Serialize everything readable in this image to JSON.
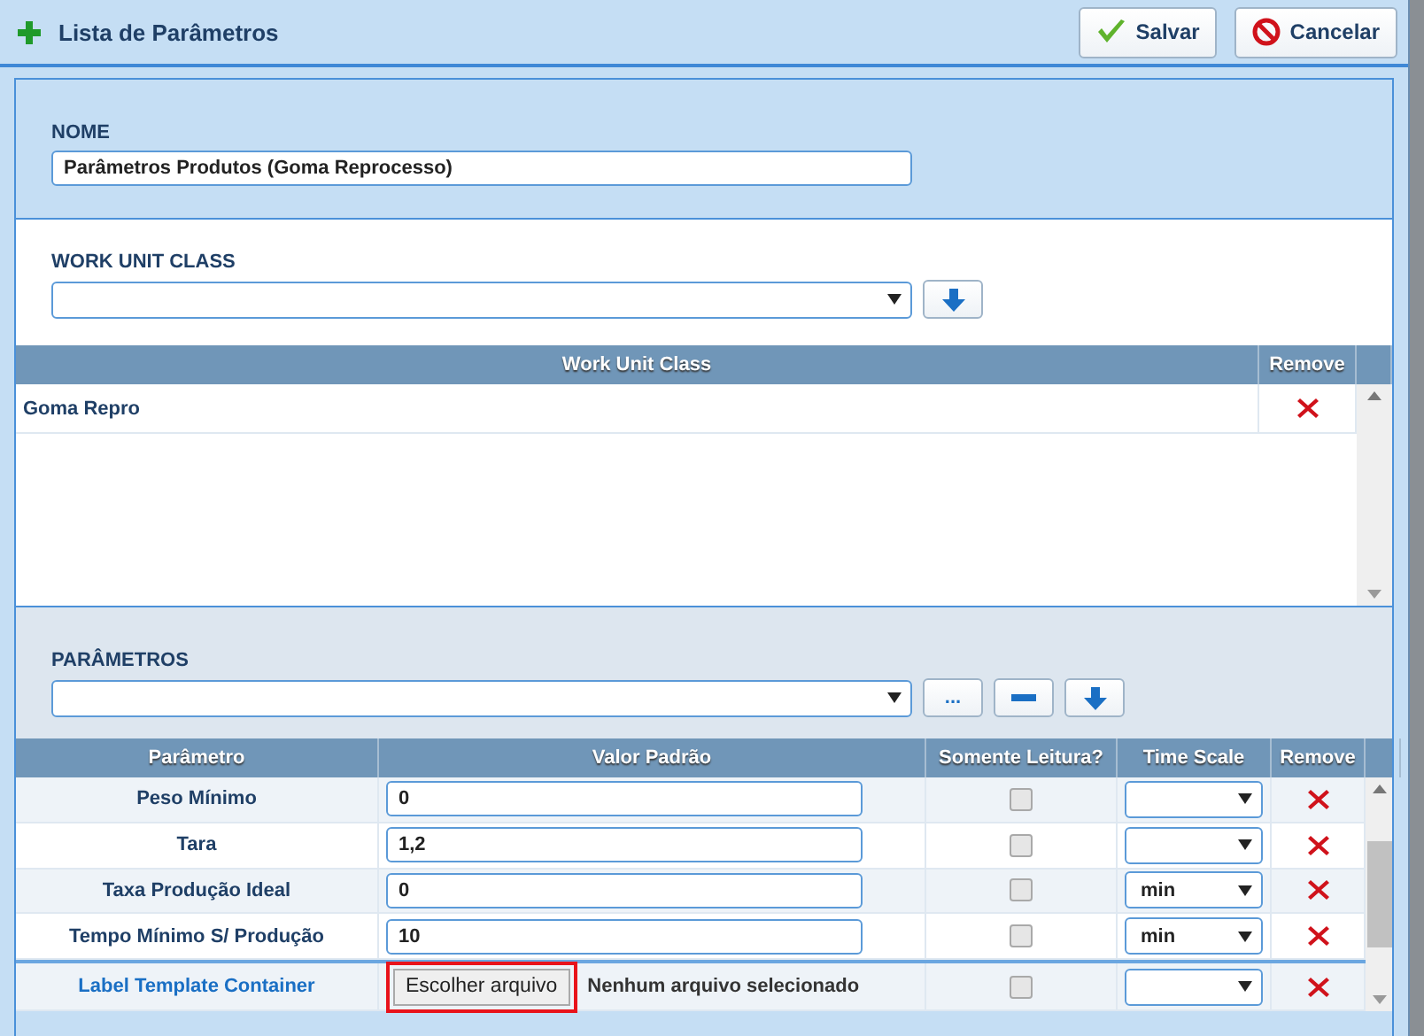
{
  "window": {
    "title": "Lista de Parâmetros"
  },
  "actions": [
    {
      "kind": "save",
      "label": "Salvar"
    },
    {
      "kind": "cancel",
      "label": "Cancelar"
    }
  ],
  "nome": {
    "label": "NOME",
    "value": "Parâmetros Produtos (Goma Reprocesso)"
  },
  "work_unit_class": {
    "label": "WORK UNIT CLASS",
    "columns": [
      "Work Unit Class",
      "Remove"
    ],
    "rows": [
      {
        "name": "Goma Repro"
      }
    ]
  },
  "parametros": {
    "label": "PARÂMETROS",
    "more_button": "...",
    "columns": [
      "Parâmetro",
      "Valor Padrão",
      "Somente Leitura?",
      "Time Scale",
      "Remove"
    ],
    "rows": [
      {
        "kind": "text",
        "name": "Peso Mínimo",
        "value": "0",
        "read_only": false,
        "time_scale": ""
      },
      {
        "kind": "text",
        "name": "Tara",
        "value": "1,2",
        "read_only": false,
        "time_scale": ""
      },
      {
        "kind": "text",
        "name": "Taxa Produção Ideal",
        "value": "0",
        "read_only": false,
        "time_scale": "min"
      },
      {
        "kind": "text",
        "name": "Tempo Mínimo S/ Produção",
        "value": "10",
        "read_only": false,
        "time_scale": "min"
      },
      {
        "kind": "file",
        "name": "Label Template Container",
        "button": "Escolher arquivo",
        "status": "Nenhum arquivo selecionado",
        "highlighted": true,
        "read_only": false,
        "time_scale": ""
      }
    ]
  }
}
